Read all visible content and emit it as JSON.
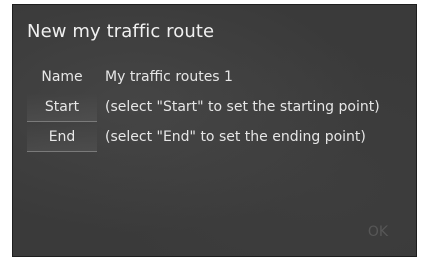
{
  "screen": {
    "title": "New my traffic route",
    "rows": [
      {
        "label": "Name",
        "value": "My traffic routes 1"
      },
      {
        "label": "Start",
        "value": "(select \"Start\" to set the starting point)"
      },
      {
        "label": "End",
        "value": "(select \"End\" to set the ending point)"
      }
    ],
    "ok_label": "OK"
  },
  "colors": {
    "screen_bg": "#3a3a3a",
    "text": "#e6e6e6",
    "disabled_text": "#575757"
  }
}
